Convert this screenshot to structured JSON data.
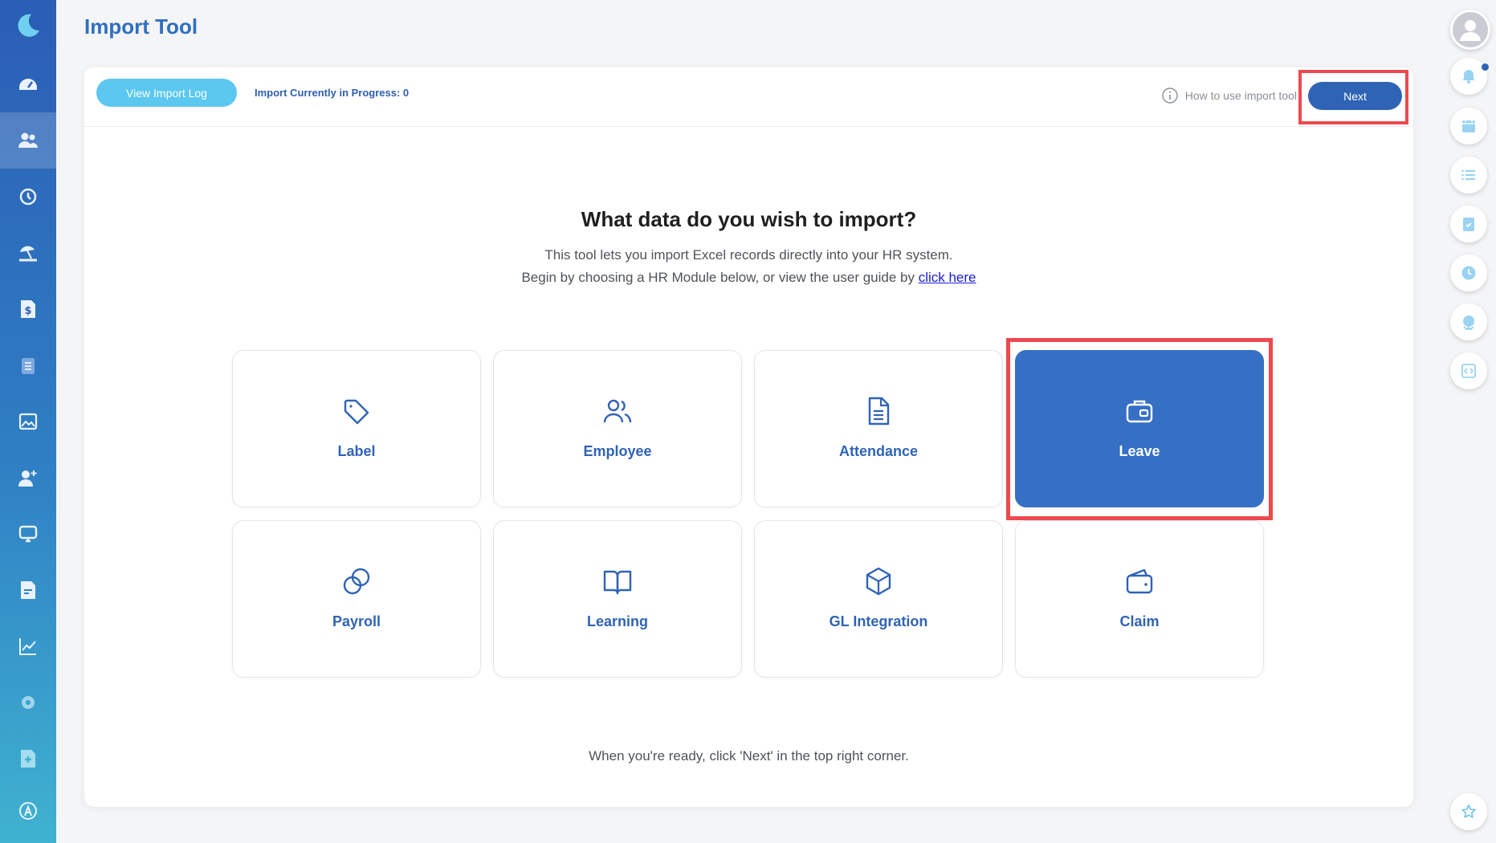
{
  "page": {
    "title": "Import Tool"
  },
  "toolbar": {
    "view_log_label": "View Import Log",
    "progress_text": "Import Currently in Progress: 0",
    "howto_label": "How to use import tool",
    "next_label": "Next"
  },
  "content": {
    "heading": "What data do you wish to import?",
    "line1": "This tool lets you import Excel records directly into your HR system.",
    "line2_prefix": "Begin by choosing a HR Module below, or view the user guide by ",
    "line2_link": "click here",
    "footer": "When you're ready, click 'Next' in the top right corner."
  },
  "modules": [
    {
      "label": "Label",
      "icon": "tag-icon",
      "selected": false
    },
    {
      "label": "Employee",
      "icon": "users-icon",
      "selected": false
    },
    {
      "label": "Attendance",
      "icon": "document-icon",
      "selected": false
    },
    {
      "label": "Leave",
      "icon": "briefcase-icon",
      "selected": true
    },
    {
      "label": "Payroll",
      "icon": "coins-icon",
      "selected": false
    },
    {
      "label": "Learning",
      "icon": "book-icon",
      "selected": false
    },
    {
      "label": "GL Integration",
      "icon": "cube-icon",
      "selected": false
    },
    {
      "label": "Claim",
      "icon": "wallet-icon",
      "selected": false
    }
  ],
  "sidebar": {
    "items": [
      {
        "icon": "dashboard-icon",
        "active": false
      },
      {
        "icon": "people-icon",
        "active": true
      },
      {
        "icon": "history-icon",
        "active": false
      },
      {
        "icon": "beach-icon",
        "active": false
      },
      {
        "icon": "payslip-icon",
        "active": false
      },
      {
        "icon": "clipboard-icon",
        "active": false
      },
      {
        "icon": "image-icon",
        "active": false
      },
      {
        "icon": "add-user-icon",
        "active": false
      },
      {
        "icon": "monitor-icon",
        "active": false
      },
      {
        "icon": "file-icon",
        "active": false
      },
      {
        "icon": "analytics-icon",
        "active": false
      },
      {
        "icon": "settings-icon",
        "active": false
      },
      {
        "icon": "medical-icon",
        "active": false
      },
      {
        "icon": "app-logo-icon",
        "active": false
      }
    ]
  },
  "rail": {
    "items": [
      "bell-icon",
      "calendar-icon",
      "list-icon",
      "clipboard-check-icon",
      "clock-icon",
      "globe-icon",
      "code-icon",
      "star-icon"
    ]
  },
  "colors": {
    "primary": "#2f63b6",
    "selected_card": "#3670c5",
    "highlight": "#ec4a4f",
    "log_button": "#5cc8f0"
  }
}
